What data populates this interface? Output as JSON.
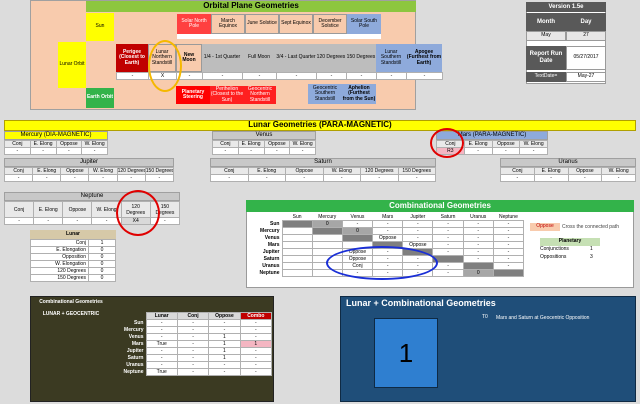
{
  "orbital": {
    "title": "Orbital Plane Geometries",
    "sun": "Sun",
    "lunar_orbit": "Lunar Orbit",
    "earth_orbit": "Earth Orbit",
    "row1": [
      "Solar North Pole",
      "March Equinox",
      "June Solstice",
      "Sept Equinox",
      "December Solstice",
      "Solar South Pole"
    ],
    "row2": [
      "Perigee (Closest to Earth)",
      "Lunar Northern Standstill",
      "New Moon",
      "1/4 - 1st Quarter",
      "Full Moon",
      "3/4 - Last Quarter",
      "120 Degrees",
      "150 Degrees",
      "Lunar Southern Standstill",
      "Apogee (Furthest from Earth)"
    ],
    "row2_vals": [
      "-",
      "X",
      "-",
      "-",
      "-",
      "-",
      "-",
      "-",
      "-",
      "-"
    ],
    "row3": [
      "Planetary Steering",
      "Perihelion (Closest to the Sun)",
      "Geocentric Northern Standstill"
    ],
    "row3b": [
      "Geocentric Southern Standstill",
      "Aphelion (Furthest from the Sun)"
    ]
  },
  "version": {
    "label": "Version 1.5e",
    "month_label": "Month",
    "day_label": "Day",
    "month": "May",
    "day": "27",
    "report_label": "Report Run Date",
    "report_date": "05/27/2017",
    "textdate_label": "TextDate=",
    "textdate": "May-27"
  },
  "lunar_geo": {
    "title": "Lunar Geometries (PARA-MAGNETIC)",
    "cols4": [
      "Conj",
      "E. Elong",
      "Oppose",
      "W. Elong"
    ],
    "cols6": [
      "Conj",
      "E. Elong",
      "Oppose",
      "W. Elong",
      "120 Degrees",
      "150 Degrees"
    ],
    "mercury": {
      "name": "Mercury (DIA-MAGNETIC)",
      "vals": [
        "-",
        "-",
        "-",
        "-"
      ]
    },
    "venus": {
      "name": "Venus",
      "vals": [
        "-",
        "-",
        "-",
        "-"
      ]
    },
    "mars": {
      "name": "Mars (PARA-MAGNETIC)",
      "vals": [
        "R3",
        "-",
        "-",
        "-"
      ]
    },
    "jupiter": {
      "name": "Jupiter",
      "vals": [
        "-",
        "-",
        "-",
        "-",
        "-",
        "-"
      ]
    },
    "saturn": {
      "name": "Saturn",
      "vals": [
        "-",
        "-",
        "-",
        "-",
        "-",
        "-"
      ]
    },
    "uranus": {
      "name": "Uranus",
      "vals": [
        "-",
        "-",
        "-",
        "-"
      ]
    },
    "neptune": {
      "name": "Neptune",
      "vals": [
        "-",
        "-",
        "-",
        "-",
        "X4",
        "-"
      ]
    }
  },
  "lunar_box": {
    "title": "Lunar",
    "rows": [
      {
        "label": "Conj",
        "value": "1"
      },
      {
        "label": "E. Elongation",
        "value": "0"
      },
      {
        "label": "Opposition",
        "value": "0"
      },
      {
        "label": "W. Elongation",
        "value": "0"
      },
      {
        "label": "120 Degrees",
        "value": "0"
      },
      {
        "label": "150 Degrees",
        "value": "0"
      }
    ]
  },
  "combo": {
    "title": "Combinational Geometries",
    "planets": [
      "Sun",
      "Mercury",
      "Venus",
      "Mars",
      "Jupiter",
      "Saturn",
      "Uranus",
      "Neptune"
    ],
    "matrix": [
      [
        "",
        "0",
        "-",
        "-",
        "-",
        "-",
        "-",
        "-"
      ],
      [
        "",
        "",
        "0",
        "-",
        "-",
        "-",
        "-",
        "-"
      ],
      [
        "",
        "",
        "",
        "Oppose",
        "-",
        "-",
        "-",
        "-"
      ],
      [
        "",
        "",
        "",
        "",
        "Oppose",
        "-",
        "-",
        "-"
      ],
      [
        "",
        "",
        "Oppose",
        "-",
        "",
        "-",
        "-",
        "-"
      ],
      [
        "",
        "",
        "Oppose",
        "-",
        "-",
        "",
        "-",
        "-"
      ],
      [
        "",
        "",
        "Conj",
        "-",
        "-",
        "-",
        "",
        "-"
      ],
      [
        "",
        "",
        "-",
        "-",
        "-",
        "-",
        "0",
        ""
      ]
    ],
    "legend_oppose": "Oppose",
    "legend_text": "Cross the connected path",
    "planetary_title": "Planetary",
    "conj_label": "Conjunctions",
    "conj_val": "1",
    "opp_label": "Oppositions",
    "opp_val": "3"
  },
  "combo_geo": {
    "title": "Combinational Geometries",
    "subtitle": "LUNAR + GEOCENTRIC",
    "cols": [
      "Lunar",
      "Conj",
      "Oppose",
      "Combo"
    ],
    "rows": [
      {
        "planet": "Sun",
        "lunar": "-",
        "conj": "-",
        "oppose": "-",
        "combo": "-"
      },
      {
        "planet": "Mercury",
        "lunar": "-",
        "conj": "-",
        "oppose": "-",
        "combo": "-"
      },
      {
        "planet": "Venus",
        "lunar": "-",
        "conj": "-",
        "oppose": "1",
        "combo": "-"
      },
      {
        "planet": "Mars",
        "lunar": "True",
        "conj": "-",
        "oppose": "1",
        "combo": "1"
      },
      {
        "planet": "Jupiter",
        "lunar": "-",
        "conj": "-",
        "oppose": "1",
        "combo": "-"
      },
      {
        "planet": "Saturn",
        "lunar": "-",
        "conj": "-",
        "oppose": "1",
        "combo": "-"
      },
      {
        "planet": "Uranus",
        "lunar": "-",
        "conj": "-",
        "oppose": "-",
        "combo": "-"
      },
      {
        "planet": "Neptune",
        "lunar": "True",
        "conj": "-",
        "oppose": "-",
        "combo": "-"
      }
    ]
  },
  "lunar_combo": {
    "title": "Lunar +  Combinational Geometries",
    "count": "1",
    "note_id": "T0",
    "note_text": "Mars and Saturn at Geocentric Opposition"
  },
  "colors": {
    "green": "#8dc63f",
    "salmon": "#f4b183",
    "yellow": "#ffff00",
    "blue": "#8eaadb",
    "red": "#ff0000",
    "navy": "#1f4e79",
    "panel_dark": "#3b3a22"
  }
}
